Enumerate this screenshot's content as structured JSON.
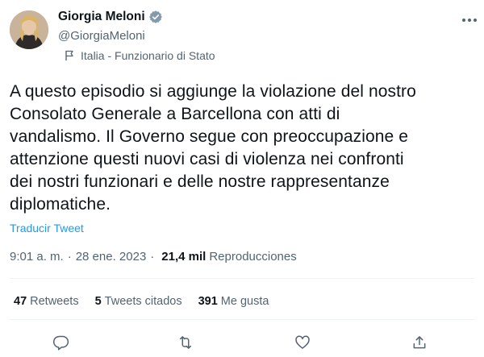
{
  "author": {
    "name": "Giorgia Meloni",
    "handle": "@GiorgiaMeloni",
    "label": "Italia - Funzionario di Stato"
  },
  "tweet": {
    "text": "A questo episodio si aggiunge la violazione del nostro\nConsolato Generale a Barcellona con atti di\nvandalismo. Il Governo segue con preoccupazione e\nattenzione questi nuovi casi di violenza nei confronti\ndei nostri funzionari e delle nostre rappresentanze\ndiplomatiche.",
    "translate_label": "Traducir Tweet",
    "time": "9:01 a. m.",
    "separator": "·",
    "date": "28 ene. 2023",
    "views": "21,4 mil",
    "views_label": "Reproducciones"
  },
  "stats": {
    "retweets_count": "47",
    "retweets_label": "Retweets",
    "quotes_count": "5",
    "quotes_label": "Tweets citados",
    "likes_count": "391",
    "likes_label": "Me gusta"
  },
  "icons": {
    "verified": "verified-badge-icon",
    "label_flag": "government-flag-icon",
    "more": "more-options-icon",
    "reply": "reply-icon",
    "retweet": "retweet-icon",
    "like": "heart-icon",
    "share": "share-icon"
  },
  "colors": {
    "accent": "#1d9bf0",
    "secondary_text": "#536471",
    "primary_text": "#0f1419",
    "divider": "#eff3f4"
  }
}
